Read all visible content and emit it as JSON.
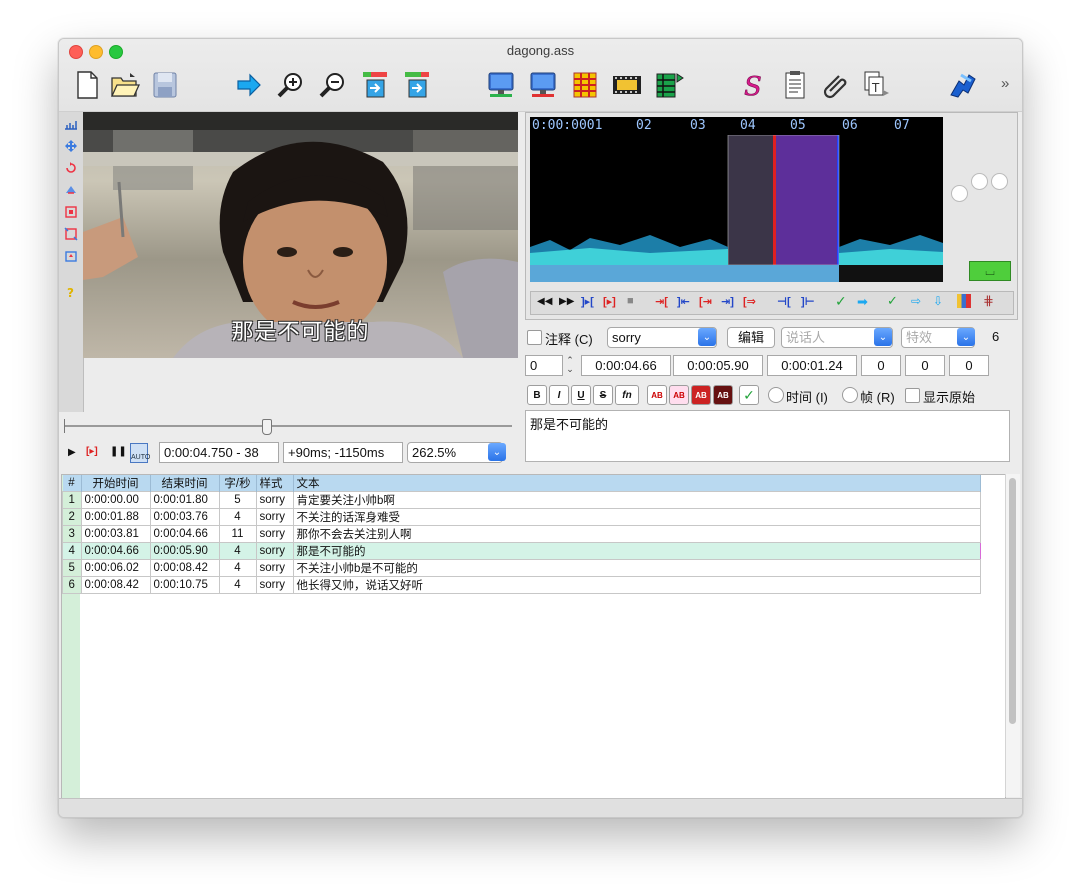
{
  "window": {
    "title": "dagong.ass"
  },
  "toolbar": {
    "overflow": "»",
    "icons": [
      "new-file-icon",
      "open-folder-icon",
      "save-icon",
      "jump-icon",
      "zoom-in-icon",
      "zoom-out-icon",
      "snap-start-icon",
      "snap-end-icon",
      "monitor-green-icon",
      "monitor-red-icon",
      "grid-icon",
      "film-icon",
      "grid-arrow-icon",
      "styles-icon",
      "document-icon",
      "paperclip-icon",
      "fonts-icon",
      "automation-icon"
    ]
  },
  "video": {
    "subtitle": "那是不可能的",
    "time": "0:00:04.750 - 38",
    "offset": "+90ms; -1150ms",
    "zoom": "262.5%",
    "seek_fraction": 0.45
  },
  "audio": {
    "timeline": [
      "0:00:0001",
      "02",
      "03",
      "04",
      "05",
      "06",
      "07"
    ],
    "commit_label": "⌴"
  },
  "editor": {
    "comment_label": "注释 (C)",
    "style": "sorry",
    "edit_button": "编辑",
    "actor_placeholder": "说话人",
    "effect_placeholder": "特效",
    "layer_count": "6",
    "layer": "0",
    "start": "0:00:04.66",
    "end": "0:00:05.90",
    "duration": "0:00:01.24",
    "margin_l": "0",
    "margin_r": "0",
    "margin_v": "0",
    "format_buttons": [
      "B",
      "I",
      "U",
      "S",
      "fn",
      "AB",
      "AB",
      "AB",
      "AB"
    ],
    "time_label": "时间 (I)",
    "frame_label": "帧 (R)",
    "show_original_label": "显示原始",
    "text": "那是不可能的",
    "commit_check": "✓"
  },
  "grid": {
    "headers": [
      "#",
      "开始时间",
      "结束时间",
      "字/秒",
      "样式",
      "文本"
    ],
    "rows": [
      [
        "1",
        "0:00:00.00",
        "0:00:01.80",
        "5",
        "sorry",
        "肯定要关注小帅b啊"
      ],
      [
        "2",
        "0:00:01.88",
        "0:00:03.76",
        "4",
        "sorry",
        "不关注的话浑身难受"
      ],
      [
        "3",
        "0:00:03.81",
        "0:00:04.66",
        "11",
        "sorry",
        "那你不会去关注别人啊"
      ],
      [
        "4",
        "0:00:04.66",
        "0:00:05.90",
        "4",
        "sorry",
        "那是不可能的"
      ],
      [
        "5",
        "0:00:06.02",
        "0:00:08.42",
        "4",
        "sorry",
        "不关注小帅b是不可能的"
      ],
      [
        "6",
        "0:00:08.42",
        "0:00:10.75",
        "4",
        "sorry",
        "他长得又帅，说话又好听"
      ]
    ],
    "selected_row": 3
  },
  "colors": {
    "accent": "#2a73e8",
    "selection": "#d4f3e7",
    "header": "#b9d9f0",
    "wave": "#3fd0d8"
  }
}
